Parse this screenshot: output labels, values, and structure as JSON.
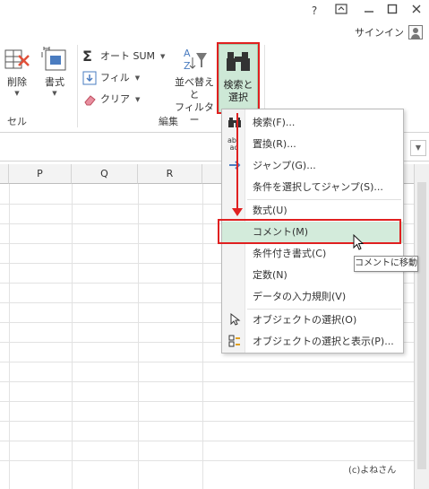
{
  "window": {
    "help": "?",
    "signin": "サインイン"
  },
  "ribbon": {
    "delete_label": "削除",
    "format_label": "書式",
    "cell_group_label": "セル",
    "autosum_label": "オート SUM",
    "fill_label": "フィル",
    "clear_label": "クリア",
    "sort_label_1": "並べ替えと",
    "sort_label_2": "フィルター",
    "find_label_1": "検索と",
    "find_label_2": "選択",
    "edit_group_label": "編集"
  },
  "columns": [
    "P",
    "Q",
    "R"
  ],
  "menu": {
    "items": [
      {
        "label": "検索(F)...",
        "icon": "binoculars-icon"
      },
      {
        "label": "置換(R)...",
        "icon": "replace-icon"
      },
      {
        "label": "ジャンプ(G)...",
        "icon": "arrow-right-icon"
      },
      {
        "label": "条件を選択してジャンプ(S)...",
        "icon": ""
      },
      {
        "label": "数式(U)",
        "icon": ""
      },
      {
        "label": "コメント(M)",
        "icon": ""
      },
      {
        "label": "条件付き書式(C)",
        "icon": ""
      },
      {
        "label": "定数(N)",
        "icon": ""
      },
      {
        "label": "データの入力規則(V)",
        "icon": ""
      },
      {
        "label": "オブジェクトの選択(O)",
        "icon": "pointer-icon"
      },
      {
        "label": "オブジェクトの選択と表示(P)...",
        "icon": "selection-pane-icon"
      }
    ],
    "highlighted_index": 5
  },
  "tooltip": "コメントに移動",
  "copyright": "(c)よねさん",
  "colors": {
    "highlight": "#d3ebdb",
    "annotation_red": "#e02020"
  }
}
